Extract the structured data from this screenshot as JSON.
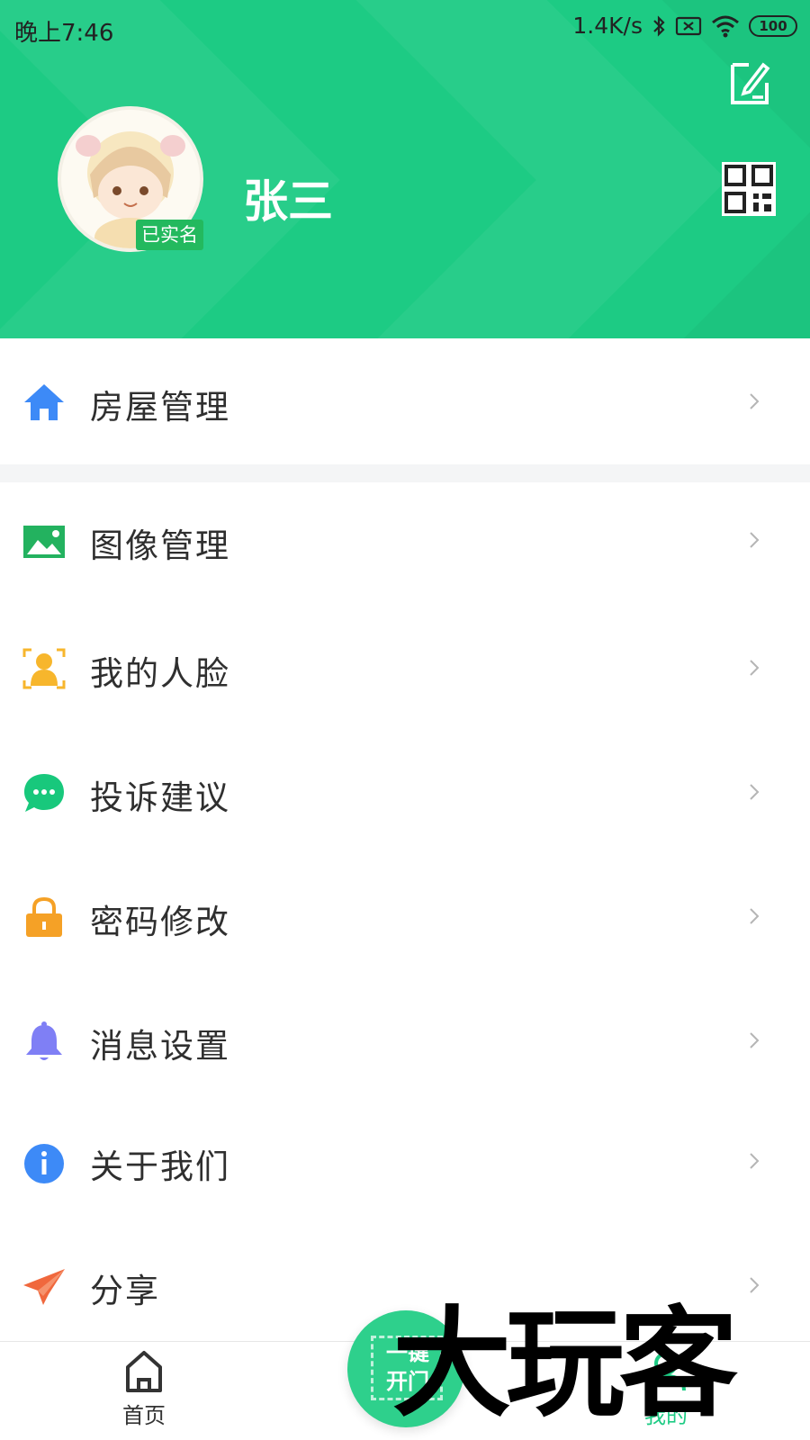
{
  "status_bar": {
    "time": "晚上7:46",
    "network_speed": "1.4K/s",
    "battery": "100"
  },
  "profile": {
    "name": "张三",
    "verified_badge": "已实名",
    "accent_color": "#1dcb84"
  },
  "menu": [
    {
      "label": "房屋管理",
      "icon": "home-icon",
      "color": "#3d8af7"
    },
    {
      "label": "图像管理",
      "icon": "image-icon",
      "color": "#23b25f"
    },
    {
      "label": "我的人脸",
      "icon": "face-icon",
      "color": "#f7b62c"
    },
    {
      "label": "投诉建议",
      "icon": "chat-icon",
      "color": "#18c87c"
    },
    {
      "label": "密码修改",
      "icon": "lock-icon",
      "color": "#f5a126"
    },
    {
      "label": "消息设置",
      "icon": "bell-icon",
      "color": "#7f7ff5"
    },
    {
      "label": "关于我们",
      "icon": "info-icon",
      "color": "#3d8af7"
    },
    {
      "label": "分享",
      "icon": "paper-plane-icon",
      "color": "#f0683d"
    }
  ],
  "bottom_nav": {
    "home_label": "首页",
    "center_line1": "一键",
    "center_line2": "开门",
    "mine_label": "我的"
  },
  "watermark": "大玩客"
}
